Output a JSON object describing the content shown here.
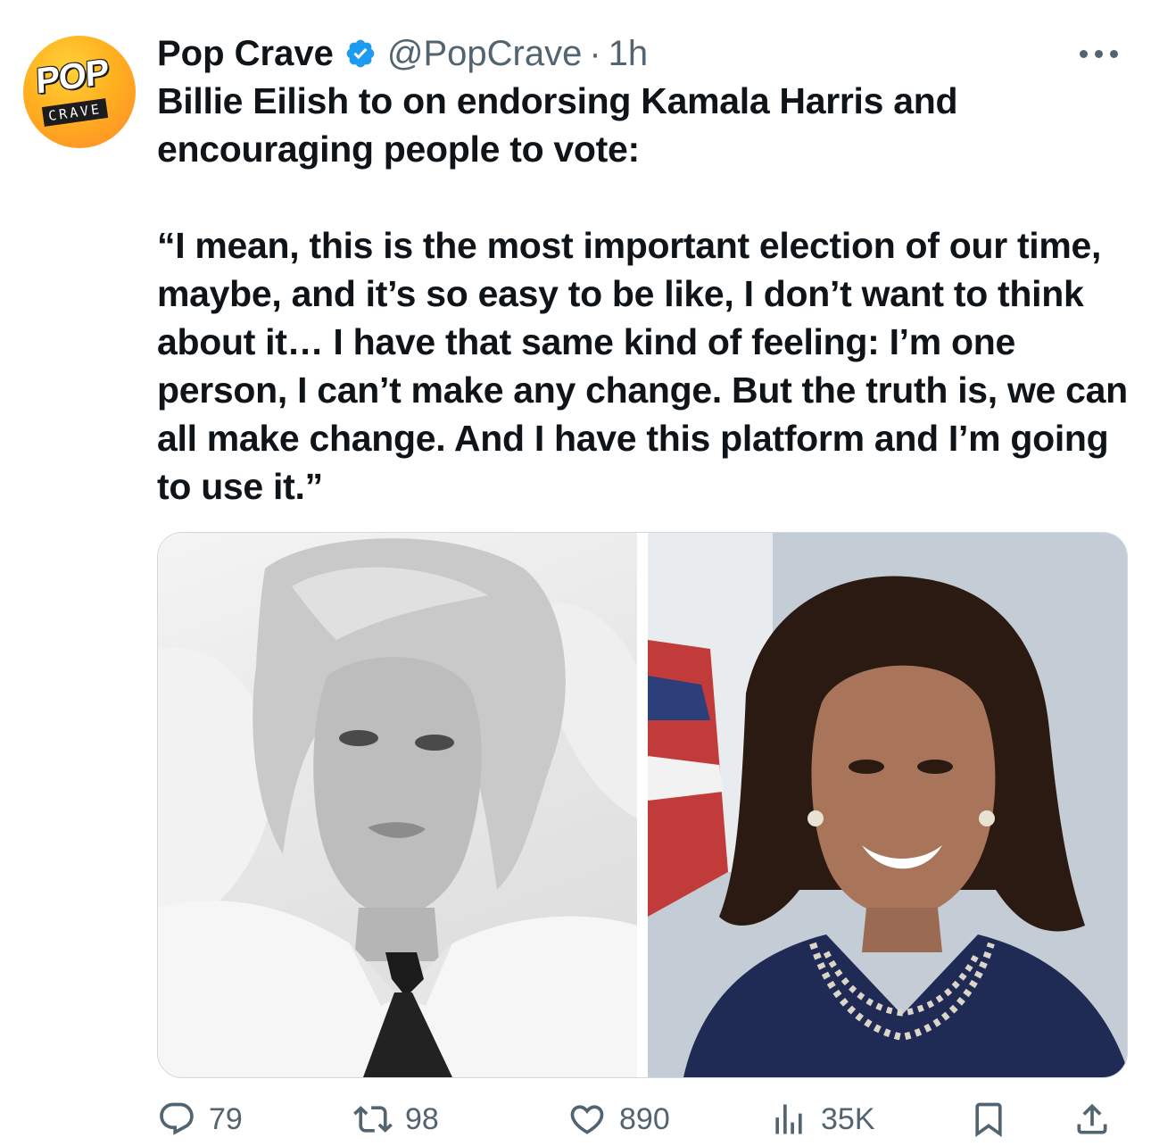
{
  "tweet": {
    "avatar": {
      "line1": "POP",
      "line2": "CRAVE"
    },
    "display_name": "Pop Crave",
    "handle": "@PopCrave",
    "separator": "·",
    "time": "1h",
    "text_paragraphs": [
      "Billie Eilish to on endorsing Kamala Harris and encouraging people to vote:",
      "“I mean, this is the most important election of our time, maybe, and it’s so easy to be like, I don’t want to think about it… I have that same kind of feeling: I’m one person, I can’t make any change. But the truth is, we can all make change. And I have this platform and I’m going to use it.”"
    ],
    "icons": {
      "verified": "verified-badge-icon",
      "more": "more-icon",
      "reply": "reply-icon",
      "retweet": "retweet-icon",
      "like": "heart-icon",
      "views": "views-icon",
      "bookmark": "bookmark-icon",
      "share": "share-icon"
    },
    "actions": {
      "replies": "79",
      "reposts": "98",
      "likes": "890",
      "views": "35K"
    },
    "colors": {
      "verified": "#1d9bf0",
      "muted": "#536471",
      "text": "#0f1419"
    }
  }
}
